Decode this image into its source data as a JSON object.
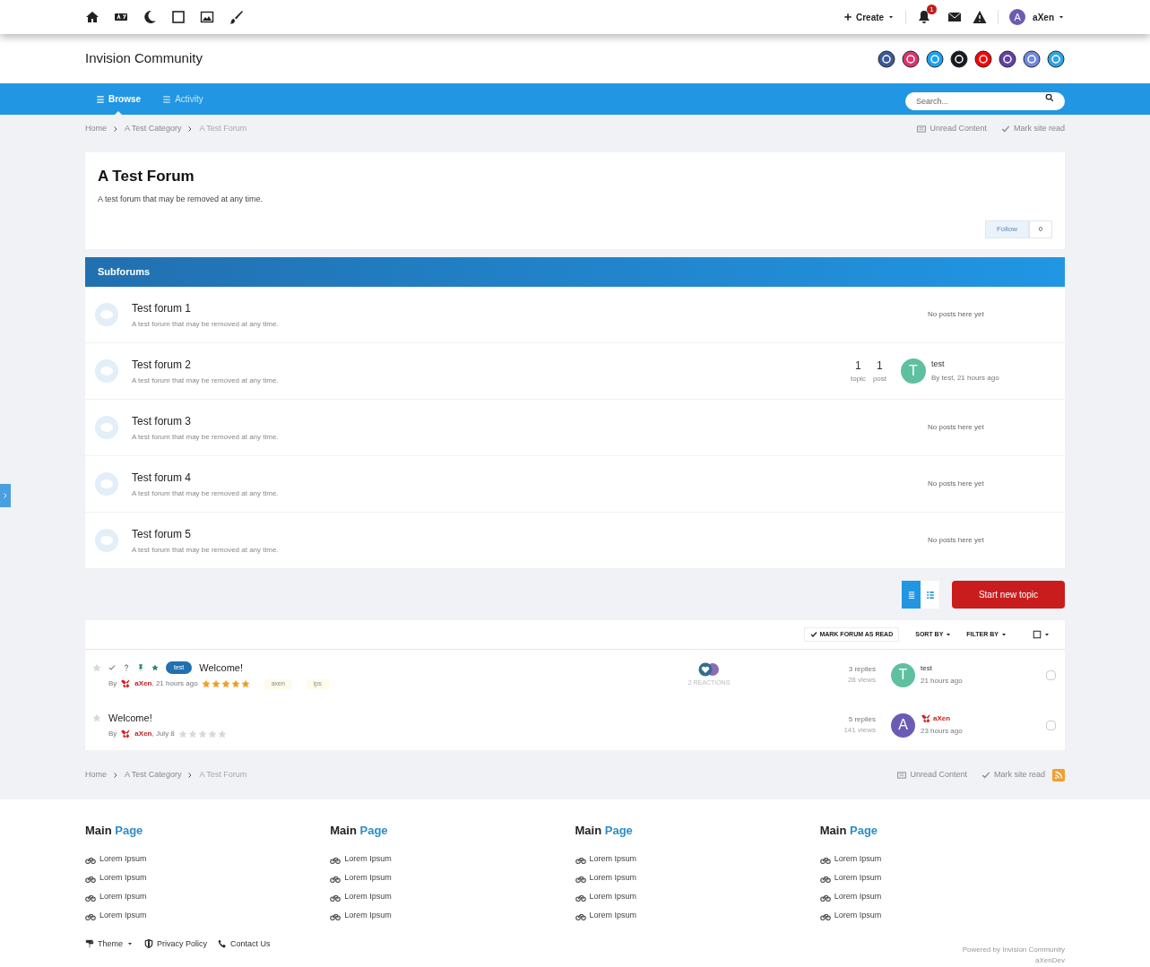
{
  "topbar": {
    "create": "Create",
    "notification_count": "1",
    "user": {
      "letter": "A",
      "name": "aXen"
    }
  },
  "header": {
    "site_title": "Invision Community"
  },
  "nav": {
    "tabs": [
      {
        "label": "Browse",
        "selected": true
      },
      {
        "label": "Activity",
        "selected": false
      }
    ],
    "search": {
      "placeholder": "Search..."
    }
  },
  "breadcrumbs": {
    "items": [
      "Home",
      "A Test Category",
      "A Test Forum"
    ],
    "actions": [
      "Unread Content",
      "Mark site read"
    ]
  },
  "forum": {
    "title": "A Test Forum",
    "description": "A test forum that may be removed at any time.",
    "follow": {
      "label": "Follow",
      "count": "0"
    }
  },
  "subforums": {
    "title": "Subforums",
    "items": [
      {
        "title": "Test forum 1",
        "description": "A test forum that may be removed at any time.",
        "kind": "empty",
        "last": "No posts here yet"
      },
      {
        "title": "Test forum 2",
        "description": "A test forum that may be removed at any time.",
        "kind": "stats",
        "topics": "1",
        "topics_label": "topic",
        "posts": "1",
        "posts_label": "post",
        "avatar": {
          "letter": "T",
          "color": "#5fc0a0"
        },
        "last_title": "test",
        "last_meta": "By test, 21 hours ago"
      },
      {
        "title": "Test forum 3",
        "description": "A test forum that may be removed at any time.",
        "kind": "empty",
        "last": "No posts here yet"
      },
      {
        "title": "Test forum 4",
        "description": "A test forum that may be removed at any time.",
        "kind": "empty",
        "last": "No posts here yet"
      },
      {
        "title": "Test forum 5",
        "description": "A test forum that may be removed at any time.",
        "kind": "empty",
        "last": "No posts here yet"
      }
    ]
  },
  "view_toggle": [
    {
      "selected": true
    },
    {
      "selected": false
    }
  ],
  "start_topic": "Start new topic",
  "toolbar": {
    "mark_read": "MARK FORUM AS READ",
    "sort": "SORT BY",
    "filter": "FILTER BY"
  },
  "topics": [
    {
      "title": "Welcome!",
      "prefix": "test",
      "flags": true,
      "by": "By",
      "byline": "**aXen**, 21 hours ago",
      "checked": false,
      "stars": 5,
      "tags": [
        "axen",
        "ips"
      ],
      "reactions": "2 REACTIONS",
      "replies": "3 replies",
      "views": "28 views",
      "avatar": {
        "letter": "T",
        "color": "#5fc0a0"
      },
      "last_author": "test",
      "last_author_staff": false,
      "last_time": "21 hours ago"
    },
    {
      "title": "Welcome!",
      "flags": false,
      "by": "By",
      "byline": "**aXen**, July 8",
      "checked": false,
      "stars": 0,
      "replies": "5 replies",
      "views": "141 views",
      "avatar": {
        "letter": "A",
        "color": "#6c5bb5"
      },
      "last_author": "aXen",
      "last_author_staff": true,
      "last_time": "23 hours ago"
    }
  ],
  "footer_breadcrumbs": {
    "items": [
      "Home",
      "A Test Category",
      "A Test Forum"
    ],
    "actions": [
      "Unread Content",
      "Mark site read"
    ]
  },
  "footer": {
    "columns": [
      {
        "title": "Main",
        "title_accent": "Page",
        "links": [
          "Lorem Ipsum",
          "Lorem Ipsum",
          "Lorem Ipsum",
          "Lorem Ipsum"
        ]
      },
      {
        "title": "Main",
        "title_accent": "Page",
        "links": [
          "Lorem Ipsum",
          "Lorem Ipsum",
          "Lorem Ipsum",
          "Lorem Ipsum"
        ]
      },
      {
        "title": "Main",
        "title_accent": "Page",
        "links": [
          "Lorem Ipsum",
          "Lorem Ipsum",
          "Lorem Ipsum",
          "Lorem Ipsum"
        ]
      },
      {
        "title": "Main",
        "title_accent": "Page",
        "links": [
          "Lorem Ipsum",
          "Lorem Ipsum",
          "Lorem Ipsum",
          "Lorem Ipsum"
        ]
      }
    ],
    "links": [
      "Theme",
      "Privacy Policy",
      "Contact Us"
    ],
    "powered": [
      "Powered by Invision Community",
      "aXenDev"
    ]
  }
}
